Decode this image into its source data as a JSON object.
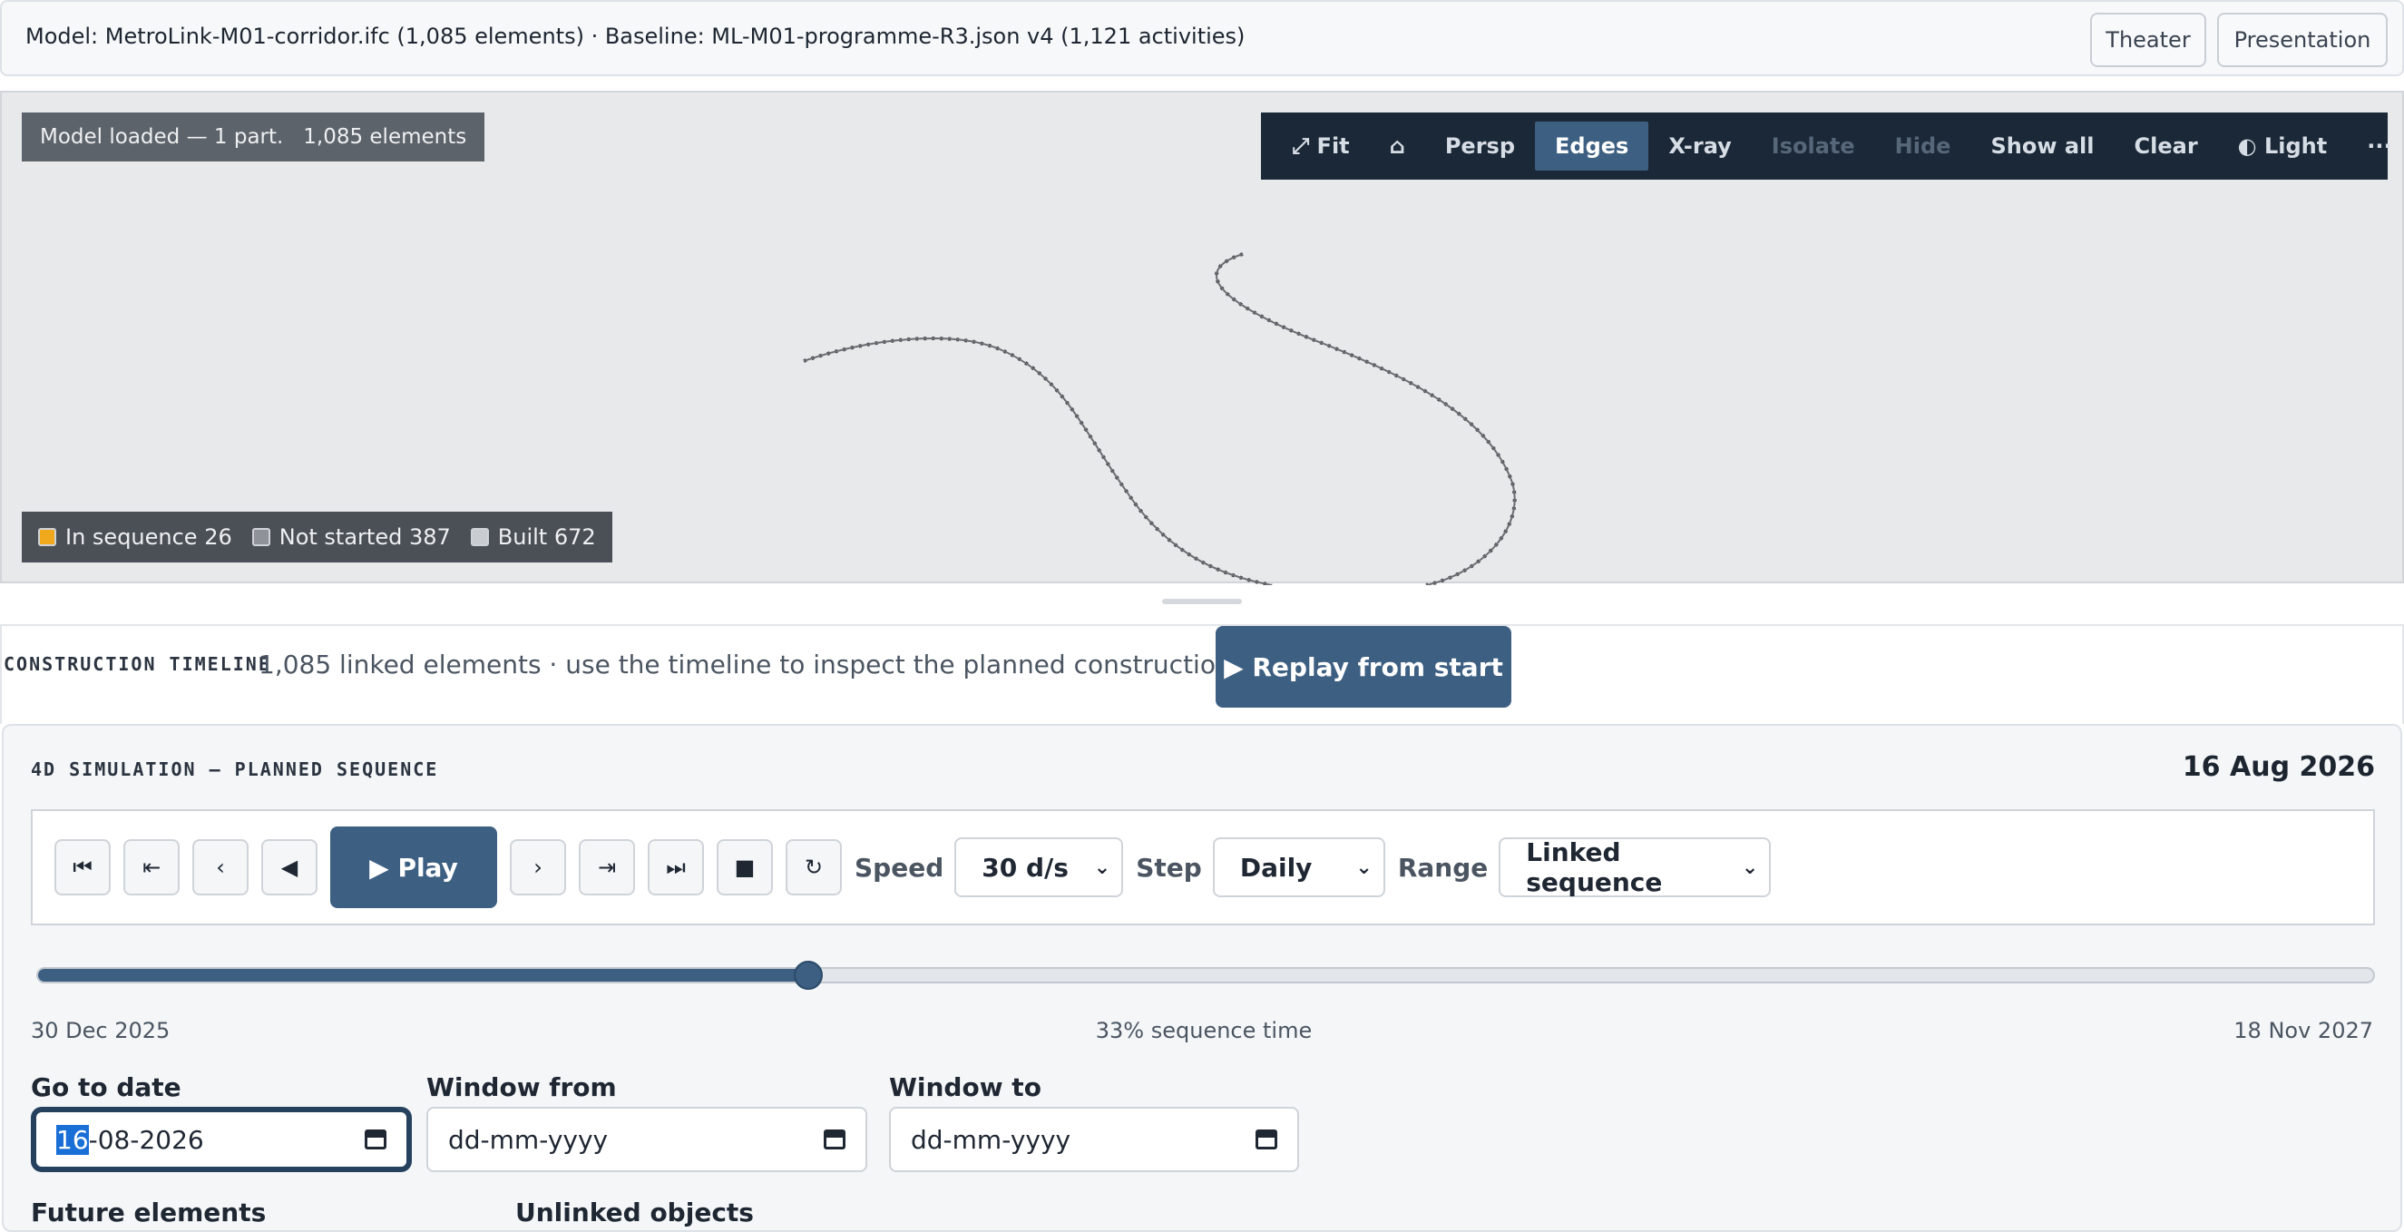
{
  "header": {
    "title": "Model: MetroLink-M01-corridor.ifc (1,085 elements) · Baseline: ML-M01-programme-R3.json v4 (1,121 activities)",
    "theater_label": "Theater",
    "presentation_label": "Presentation"
  },
  "viewer": {
    "loaded_badge": "Model loaded — 1 part.   1,085 elements",
    "toolbar": {
      "fit": "⤢ Fit",
      "home": "⌂",
      "persp": "Persp",
      "edges": "Edges",
      "xray": "X-ray",
      "isolate": "Isolate",
      "hide": "Hide",
      "show_all": "Show all",
      "clear": "Clear",
      "light": "◐ Light",
      "more": "···",
      "fullscreen": "⤢⤢"
    },
    "legend": [
      {
        "label": "In sequence 26",
        "color": "#f0a81c"
      },
      {
        "label": "Not started 387",
        "color": "#8f9399"
      },
      {
        "label": "Built 672",
        "color": "#c9ccd0"
      }
    ]
  },
  "timeline": {
    "section_label": "CONSTRUCTION TIMELINE",
    "description": "1,085 linked elements · use the timeline to inspect the planned construction state.",
    "replay_label": "▶ Replay from start"
  },
  "simulation": {
    "section_label": "4D SIMULATION — PLANNED SEQUENCE",
    "current_date": "16 Aug 2026",
    "controls": {
      "first": "⏮",
      "step_back_far": "⇤",
      "step_back": "‹",
      "reverse": "◀",
      "play_label": "▶ Play",
      "step_fwd": "›",
      "step_fwd_far": "⇥",
      "last": "⏭",
      "stop": "■",
      "loop": "↻",
      "speed_label": "Speed",
      "speed_value": "30 d/s",
      "step_label": "Step",
      "step_value": "Daily",
      "range_label": "Range",
      "range_value": "Linked sequence"
    },
    "progress": 0.33,
    "range_start": "30 Dec 2025",
    "range_center": "33% sequence time",
    "range_end": "18 Nov 2027",
    "go_to_date_label": "Go to date",
    "go_to_date_day": "16",
    "go_to_date_rest": "-08-2026",
    "window_from_label": "Window from",
    "window_from_placeholder": "dd-mm-yyyy",
    "window_to_label": "Window to",
    "window_to_placeholder": "dd-mm-yyyy",
    "future_elements_label": "Future elements",
    "unlinked_objects_label": "Unlinked objects"
  }
}
